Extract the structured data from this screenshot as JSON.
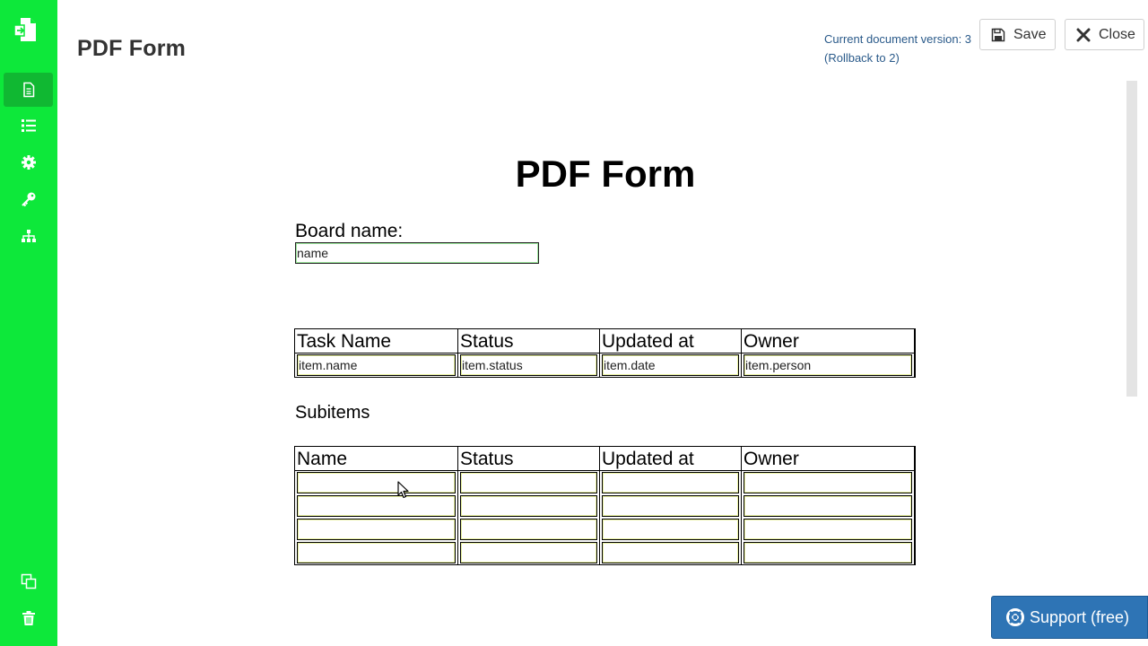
{
  "header": {
    "title": "PDF Form",
    "version_text": "Current document version: 3",
    "rollback_text": "(Rollback to 2)",
    "save_label": "Save",
    "close_label": "Close"
  },
  "sidebar": {
    "items": [
      {
        "icon": "document-icon",
        "active": true
      },
      {
        "icon": "list-icon",
        "active": false
      },
      {
        "icon": "gear-icon",
        "active": false
      },
      {
        "icon": "key-icon",
        "active": false
      },
      {
        "icon": "sitemap-icon",
        "active": false
      },
      {
        "icon": "copy-icon",
        "active": false
      },
      {
        "icon": "trash-icon",
        "active": false
      }
    ],
    "accent_color": "#0de83a"
  },
  "form": {
    "title": "PDF Form",
    "board_label": "Board name:",
    "board_field_value": "name",
    "main_table": {
      "headers": [
        "Task Name",
        "Status",
        "Updated at",
        "Owner"
      ],
      "rows": [
        [
          "item.name",
          "item.status",
          "item.date",
          "item.person"
        ]
      ]
    },
    "subitems_label": "Subitems",
    "sub_table": {
      "headers": [
        "Name",
        "Status",
        "Updated at",
        "Owner"
      ],
      "rows": [
        [
          "",
          "",
          "",
          ""
        ],
        [
          "",
          "",
          "",
          ""
        ],
        [
          "",
          "",
          "",
          ""
        ],
        [
          "",
          "",
          "",
          ""
        ]
      ]
    }
  },
  "support": {
    "label": "Support (free)",
    "color": "#2e74b5"
  }
}
